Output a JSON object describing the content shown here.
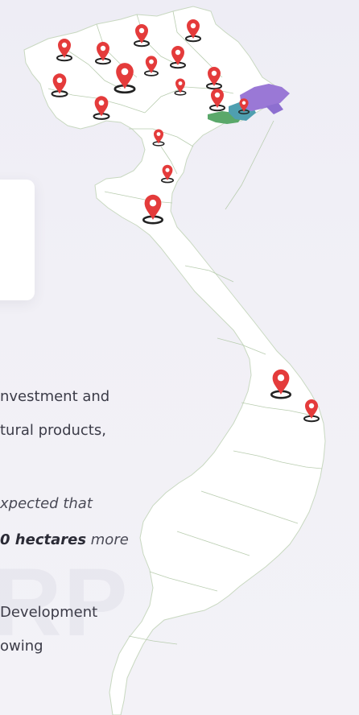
{
  "watermark": "RP",
  "text": {
    "line1": "nvestment and",
    "line2": "tural products,",
    "line3": "xpected that",
    "line4_bold": "0 hectares",
    "line4_rest": " more",
    "line5": "Development",
    "line6": "owing"
  },
  "map": {
    "province_colors": {
      "base": "#ffffff",
      "border": "#b9cdb0",
      "green": "#5aa86a",
      "teal": "#4f9fb0",
      "purple": "#9a78d6"
    },
    "marker_color": "#e43b3b",
    "markers": [
      "location-pin-icon",
      "location-pin-icon",
      "location-pin-icon",
      "location-pin-icon",
      "location-pin-icon",
      "location-pin-icon",
      "location-pin-icon",
      "location-pin-icon",
      "location-pin-icon",
      "location-pin-icon",
      "location-pin-icon",
      "location-pin-icon",
      "location-pin-icon",
      "location-pin-icon",
      "location-pin-icon",
      "location-pin-icon",
      "location-pin-icon"
    ]
  }
}
